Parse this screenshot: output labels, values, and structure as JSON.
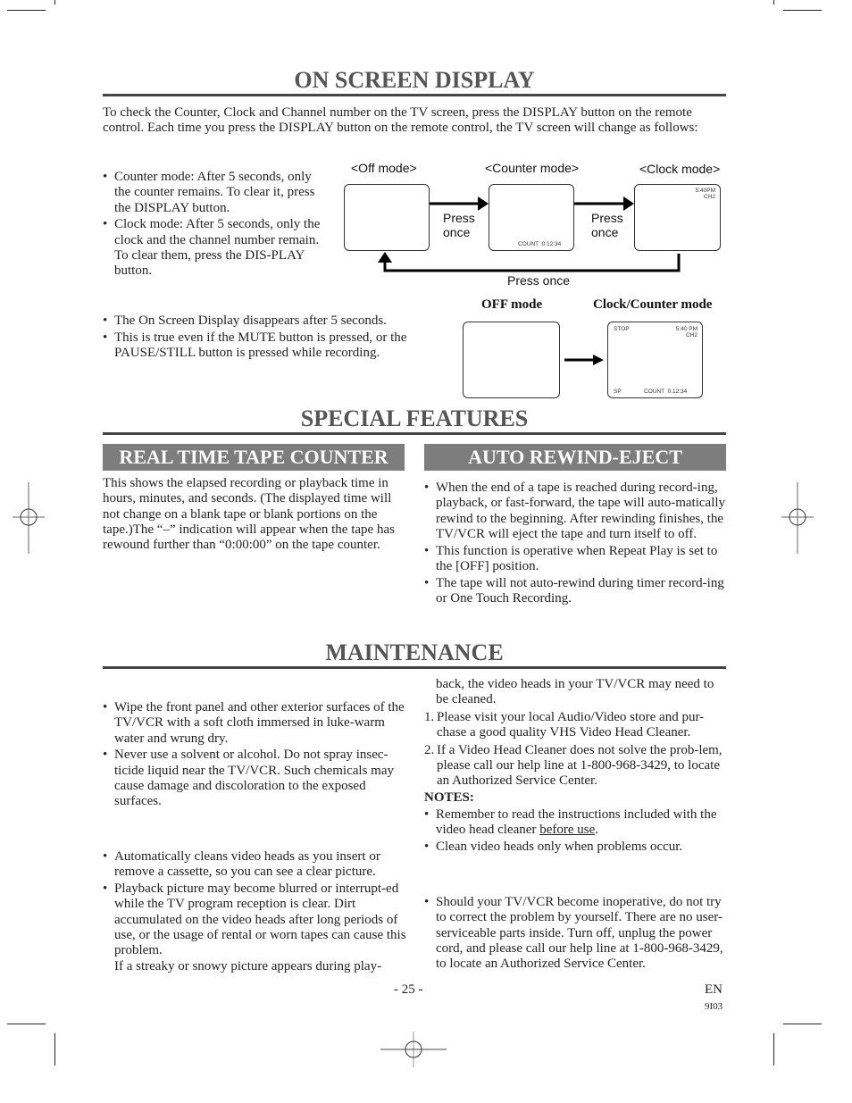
{
  "sections": {
    "on_screen_display": {
      "title": "ON SCREEN DISPLAY",
      "intro": "To check the Counter, Clock and Channel number on the TV screen, press the DISPLAY button on the remote control. Each time you press the DISPLAY button on the remote control, the TV screen will change as follows:",
      "bullets_top": [
        "Counter mode: After 5 seconds, only the counter remains. To clear it, press the DISPLAY button.",
        "Clock mode: After 5 seconds, only the clock and the channel number remain. To clear them, press the DIS-PLAY button."
      ],
      "diagram": {
        "off_mode_label": "<Off mode>",
        "counter_mode_label": "<Counter mode>",
        "clock_mode_label": "<Clock mode>",
        "press_once_1_line1": "Press",
        "press_once_1_line2": "once",
        "press_once_2_line1": "Press",
        "press_once_2_line2": "once",
        "press_once_return": "Press once",
        "counter_screen_text": "COUNT  0:12:34",
        "clock_screen_time": "5:40PM",
        "clock_screen_channel": "CH2"
      },
      "bullets_bottom": [
        "The On Screen Display disappears after 5 seconds.",
        "This is true even if the MUTE button is pressed, or the PAUSE/STILL button is pressed while recording."
      ],
      "diagram2": {
        "off_label": "OFF mode",
        "clock_counter_label": "Clock/Counter mode",
        "status": "STOP",
        "time": "5:40 PM",
        "channel": "CH2",
        "speed": "SP",
        "count": "COUNT  0:12:34"
      }
    },
    "special_features": {
      "title": "SPECIAL FEATURES",
      "real_time": {
        "heading": "REAL TIME TAPE COUNTER",
        "body": "This shows the elapsed recording or playback time in hours, minutes, and seconds. (The displayed time will not change on a blank tape or blank portions on the tape.)The “–” indication will appear when the tape has rewound further than “0:00:00” on the tape counter."
      },
      "auto_rewind": {
        "heading": "AUTO REWIND-EJECT",
        "bullets": [
          "When the end of a tape is reached during record-ing, playback, or fast-forward, the tape will auto-matically rewind to the beginning. After rewinding finishes, the TV/VCR will eject the tape and turn itself to off.",
          "This function is operative when Repeat Play is set to the [OFF] position.",
          "The tape will not auto-rewind during timer record-ing or One Touch Recording."
        ]
      }
    },
    "maintenance": {
      "title": "MAINTENANCE",
      "cabinet_bullets": [
        "Wipe the front panel and other exterior surfaces of the TV/VCR with a soft cloth immersed in luke-warm water and wrung dry.",
        "Never use a solvent or alcohol. Do not spray insec-ticide liquid near the TV/VCR. Such chemicals may cause damage and discoloration to the exposed surfaces."
      ],
      "head_bullets": [
        "Automatically cleans video heads as you insert or remove a cassette, so you can see a clear picture.",
        "Playback picture may become blurred or interrupt-ed while the TV program reception is clear. Dirt accumulated on the video heads after long periods of use, or the usage of rental or worn tapes can cause this problem."
      ],
      "head_continuation_1": "If a streaky or snowy picture appears during play-",
      "head_continuation_2": "back, the video heads in your TV/VCR may need to be cleaned.",
      "steps": [
        {
          "num": "1.",
          "text": "Please visit your local Audio/Video store and pur-chase a good quality VHS Video Head Cleaner."
        },
        {
          "num": "2.",
          "text": "If a Video Head Cleaner does not solve the prob-lem, please call our help line at 1-800-968-3429, to locate an Authorized Service Center."
        }
      ],
      "notes_label": "NOTES:",
      "note_1_prefix": "Remember to read the instructions included with the video head cleaner ",
      "note_1_underlined": "before use",
      "note_1_suffix": ".",
      "note_2": "Clean video heads only when problems occur.",
      "service_bullet": "Should your TV/VCR become inoperative, do not try to correct the problem by yourself. There are no user-serviceable parts inside. Turn off, unplug the power cord, and please call our help line at 1-800-968-3429, to locate an Authorized Service Center."
    }
  },
  "footer": {
    "page_number": "- 25 -",
    "language": "EN",
    "code": "9I03"
  }
}
